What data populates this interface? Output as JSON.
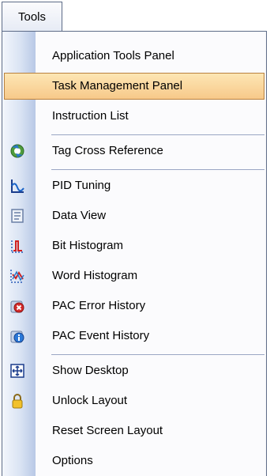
{
  "menu": {
    "title": "Tools",
    "items": [
      {
        "label": "Application Tools Panel",
        "icon": "none"
      },
      {
        "label": "Task Management Panel",
        "icon": "none",
        "selected": true
      },
      {
        "label": "Instruction List",
        "icon": "none"
      },
      {
        "label": "Tag Cross Reference",
        "icon": "tag-cross-reference-icon"
      },
      {
        "label": "PID Tuning",
        "icon": "pid-tuning-icon"
      },
      {
        "label": "Data View",
        "icon": "data-view-icon"
      },
      {
        "label": "Bit Histogram",
        "icon": "bit-histogram-icon"
      },
      {
        "label": "Word Histogram",
        "icon": "word-histogram-icon"
      },
      {
        "label": "PAC Error History",
        "icon": "pac-error-history-icon"
      },
      {
        "label": "PAC Event History",
        "icon": "pac-event-history-icon"
      },
      {
        "label": "Show Desktop",
        "icon": "show-desktop-icon"
      },
      {
        "label": "Unlock Layout",
        "icon": "lock-icon"
      },
      {
        "label": "Reset Screen Layout",
        "icon": "none"
      },
      {
        "label": "Options",
        "icon": "none"
      }
    ]
  },
  "colors": {
    "highlight": "#f7c98a",
    "border": "#5d6b87",
    "gutter": "#b8c8e6"
  }
}
